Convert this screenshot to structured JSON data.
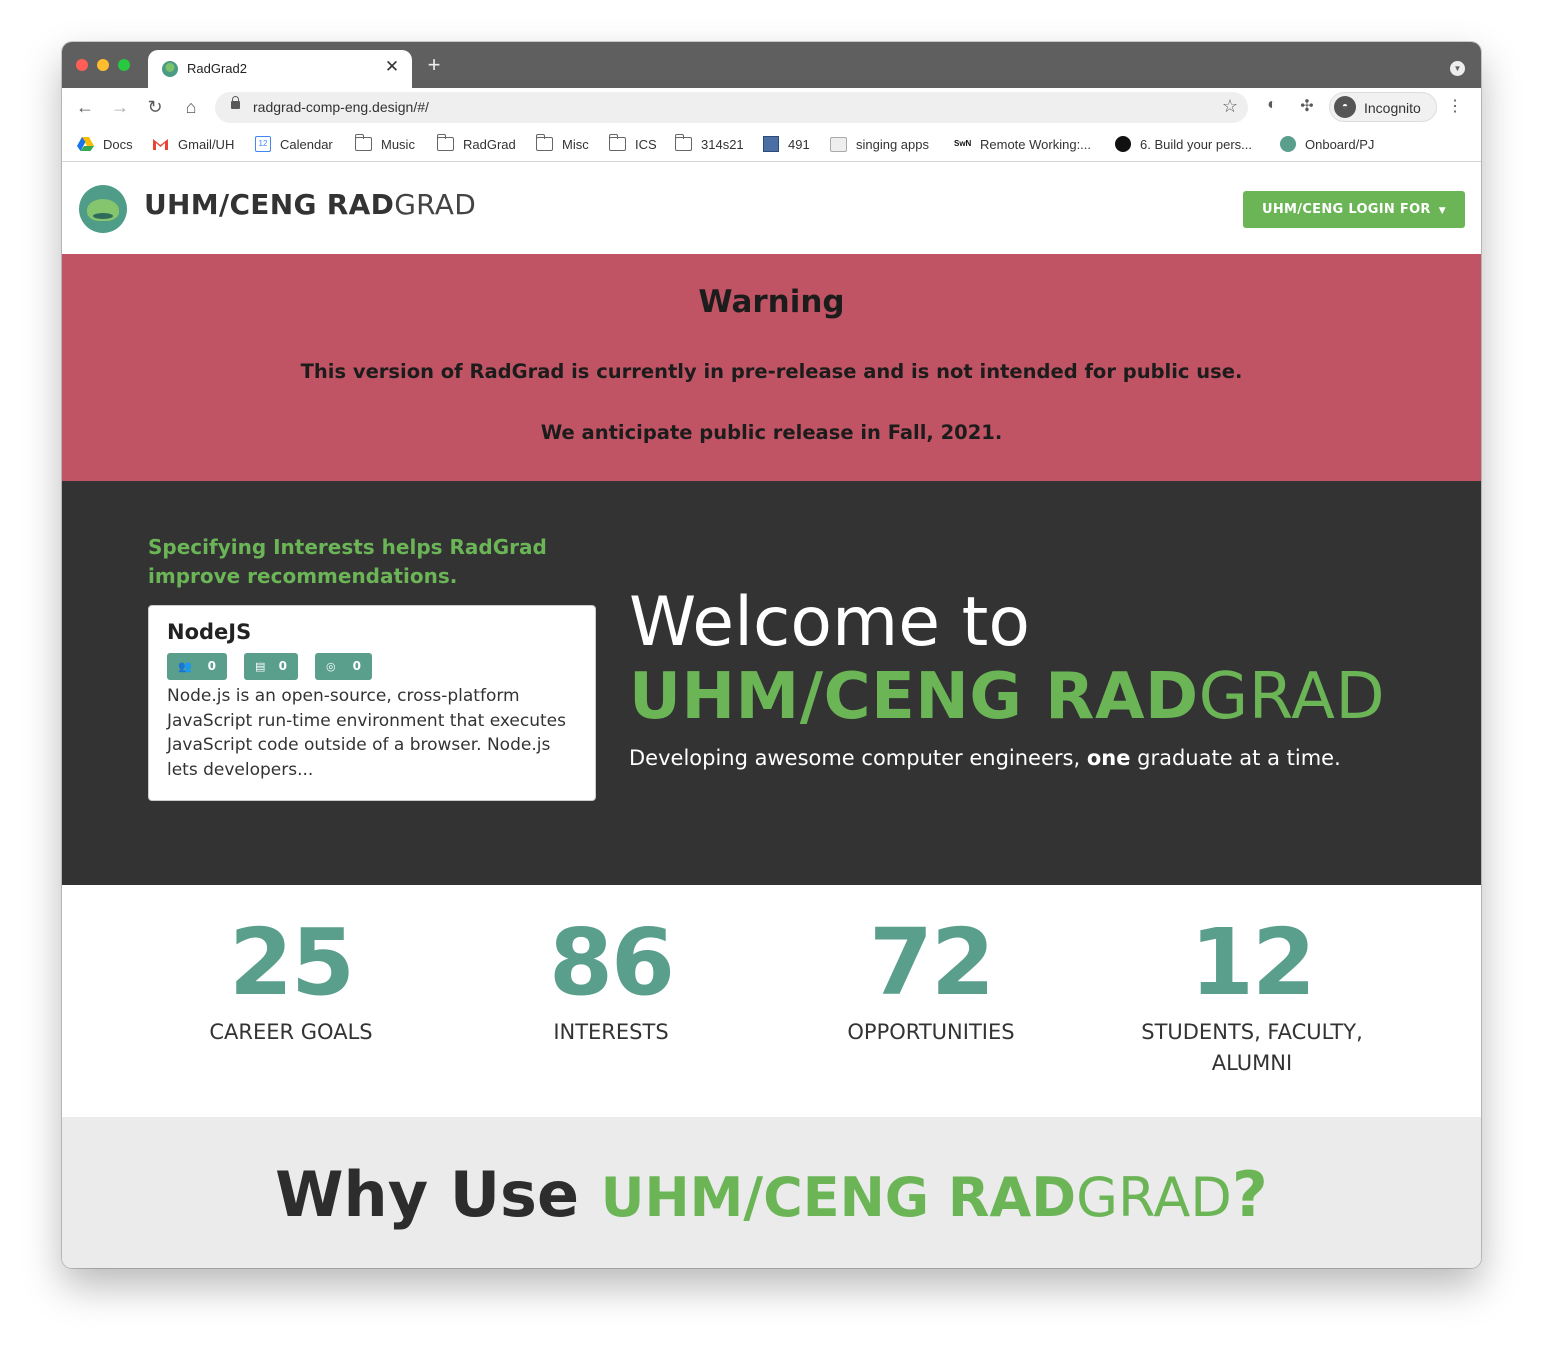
{
  "browser": {
    "tab_title": "RadGrad2",
    "tab_close": "✕",
    "new_tab": "+",
    "url": "radgrad-comp-eng.design/#/",
    "profile_label": "Incognito",
    "bookmarks": [
      {
        "label": "Docs",
        "icon": "google-drive-icon"
      },
      {
        "label": "Gmail/UH",
        "icon": "gmail-icon"
      },
      {
        "label": "Calendar",
        "icon": "calendar-icon"
      },
      {
        "label": "Music",
        "icon": "folder-icon"
      },
      {
        "label": "RadGrad",
        "icon": "folder-icon"
      },
      {
        "label": "Misc",
        "icon": "folder-icon"
      },
      {
        "label": "ICS",
        "icon": "folder-icon"
      },
      {
        "label": "314s21",
        "icon": "folder-icon"
      },
      {
        "label": "491",
        "icon": "square-icon"
      },
      {
        "label": "singing apps",
        "icon": "app-icon"
      },
      {
        "label": "Remote Working:...",
        "icon": "swn-icon"
      },
      {
        "label": "6. Build your pers...",
        "icon": "github-icon"
      },
      {
        "label": "Onboard/PJ",
        "icon": "globe-icon"
      }
    ],
    "bookmark_icon_text": {
      "calendar": "12",
      "swn": "SwN"
    }
  },
  "header": {
    "brand_bold": "UHM/CENG RAD",
    "brand_light": "GRAD",
    "login_label": "UHM/CENG LOGIN FOR"
  },
  "warning": {
    "title": "Warning",
    "line1": "This version of RadGrad is currently in pre-release and is not intended for public use.",
    "line2": "We anticipate public release in Fall, 2021."
  },
  "hero": {
    "note": "Specifying Interests helps RadGrad improve recommendations.",
    "card": {
      "title": "NodeJS",
      "chips": [
        {
          "icon": "users-icon",
          "count": "0"
        },
        {
          "icon": "book-icon",
          "count": "0"
        },
        {
          "icon": "target-icon",
          "count": "0"
        }
      ],
      "description": "Node.js is an open-source, cross-platform JavaScript run-time environment that executes JavaScript code outside of a browser. Node.js lets developers..."
    },
    "welcome": "Welcome to",
    "brand_bold": "UHM/CENG RAD",
    "brand_light": "GRAD",
    "tagline_pre": "Developing awesome computer engineers, ",
    "tagline_bold": "one",
    "tagline_post": " graduate at a time."
  },
  "stats": [
    {
      "value": "25",
      "label": "CAREER GOALS"
    },
    {
      "value": "86",
      "label": "INTERESTS"
    },
    {
      "value": "72",
      "label": "OPPORTUNITIES"
    },
    {
      "value": "12",
      "label": "STUDENTS, FACULTY, ALUMNI"
    }
  ],
  "why": {
    "prefix": "Why Use ",
    "brand_bold": "UHM/CENG RAD",
    "brand_light": "GRAD",
    "suffix": "?"
  },
  "colors": {
    "green": "#6bb557",
    "teal": "#5a9e8c",
    "warning": "#c05464",
    "dark": "#333333"
  }
}
